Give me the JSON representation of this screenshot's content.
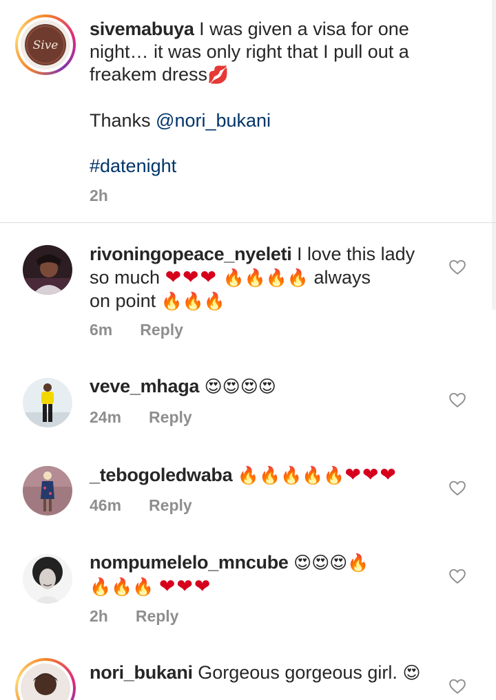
{
  "caption": {
    "username": "sivemabuya",
    "line1": "I was given a visa for one",
    "line2": "night… it was only right that I pull out a",
    "line3_text": "freakem dress",
    "line3_emoji": "💋",
    "thanks_prefix": "Thanks ",
    "mention": "@nori_bukani",
    "hashtag": "#datenight",
    "time": "2h",
    "avatar_logo_text": "Sive"
  },
  "comments": [
    {
      "username": "rivoningopeace_nyeleti",
      "line1": "I love this lady",
      "line2_text": "so much",
      "line2_hearts": "❤❤❤",
      "line2_fire": "🔥🔥🔥🔥",
      "line2_tail": "always",
      "line3_text": "on point",
      "line3_fire": "🔥🔥🔥",
      "time": "6m",
      "reply": "Reply"
    },
    {
      "username": "veve_mhaga",
      "emojis": "😍😍😍😍",
      "time": "24m",
      "reply": "Reply"
    },
    {
      "username": "_tebogoledwaba",
      "fire": "🔥🔥🔥🔥🔥",
      "hearts": "❤❤❤",
      "time": "46m",
      "reply": "Reply"
    },
    {
      "username": "nompumelelo_mncube",
      "line1_emojis": "😍😍😍🔥",
      "line2_fire": "🔥🔥🔥",
      "line2_hearts": "❤❤❤",
      "time": "2h",
      "reply": "Reply"
    },
    {
      "username": "nori_bukani",
      "text": "Gorgeous gorgeous girl.",
      "emoji": "😍"
    }
  ],
  "colors": {
    "text": "#262626",
    "muted": "#8e8e8e",
    "link": "#003569",
    "divider": "#dbdbdb"
  },
  "icons": {
    "like": "heart-outline-icon"
  }
}
